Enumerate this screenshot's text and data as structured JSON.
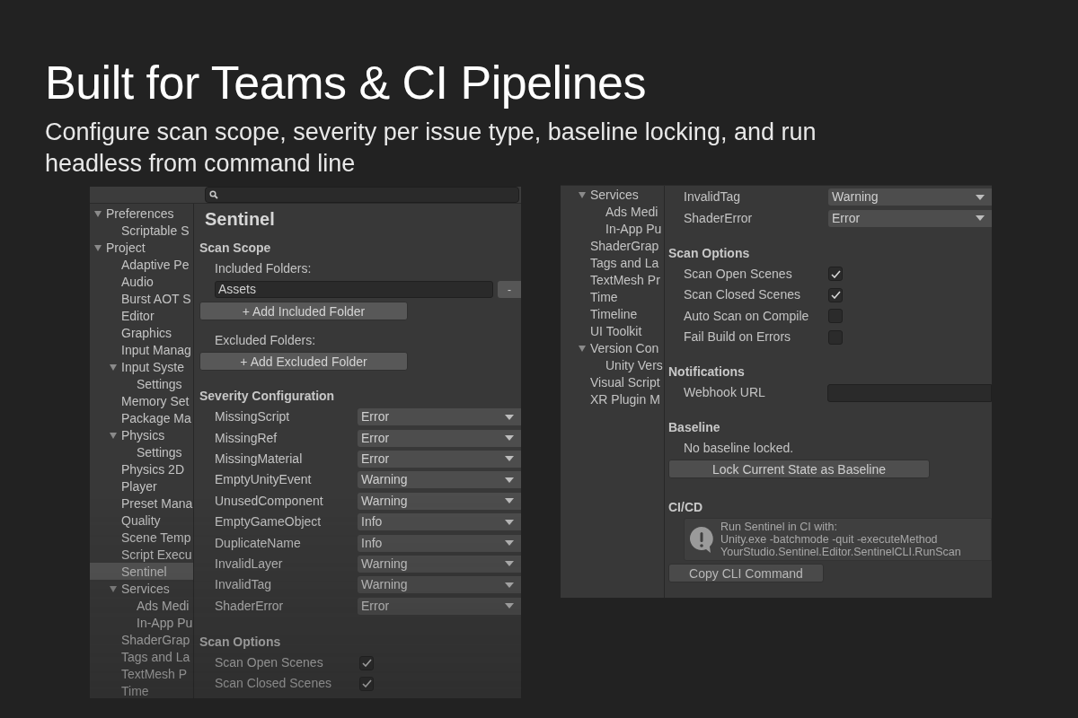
{
  "headline": "Built for Teams & CI Pipelines",
  "subheadline": "Configure scan scope, severity per issue type, baseline locking, and run headless from command line",
  "left_window": {
    "sidebar": {
      "items": [
        {
          "label": "Preferences",
          "selected": false,
          "expanded": true,
          "children": [
            {
              "label": "Scriptable S",
              "selected": false
            }
          ]
        },
        {
          "label": "Project",
          "selected": false,
          "expanded": true,
          "children": [
            {
              "label": "Adaptive Pe",
              "selected": false
            },
            {
              "label": "Audio",
              "selected": false
            },
            {
              "label": "Burst AOT S",
              "selected": false
            },
            {
              "label": "Editor",
              "selected": false
            },
            {
              "label": "Graphics",
              "selected": false
            },
            {
              "label": "Input Manag",
              "selected": false
            },
            {
              "label": "Input Syste",
              "selected": false,
              "expanded": true,
              "children": [
                {
                  "label": "Settings",
                  "selected": false
                }
              ]
            },
            {
              "label": "Memory Set",
              "selected": false
            },
            {
              "label": "Package Ma",
              "selected": false
            },
            {
              "label": "Physics",
              "selected": false,
              "expanded": true,
              "children": [
                {
                  "label": "Settings",
                  "selected": false
                }
              ]
            },
            {
              "label": "Physics 2D",
              "selected": false
            },
            {
              "label": "Player",
              "selected": false
            },
            {
              "label": "Preset Mana",
              "selected": false
            },
            {
              "label": "Quality",
              "selected": false
            },
            {
              "label": "Scene Temp",
              "selected": false
            },
            {
              "label": "Script Execu",
              "selected": false
            },
            {
              "label": "Sentinel",
              "selected": true
            },
            {
              "label": "Services",
              "selected": false,
              "expanded": true,
              "children": [
                {
                  "label": "Ads Medi",
                  "selected": false
                },
                {
                  "label": "In-App Pu",
                  "selected": false
                }
              ]
            },
            {
              "label": "ShaderGrap",
              "selected": false
            },
            {
              "label": "Tags and La",
              "selected": false
            },
            {
              "label": "TextMesh P",
              "selected": false
            },
            {
              "label": "Time",
              "selected": false
            }
          ]
        }
      ]
    },
    "title": "Sentinel",
    "scan_scope": {
      "heading": "Scan Scope",
      "included_label": "Included Folders:",
      "included_folders": [
        {
          "value": "Assets",
          "remove_button": "-"
        }
      ],
      "add_included_button": "+ Add Included Folder",
      "excluded_label": "Excluded Folders:",
      "add_excluded_button": "+ Add Excluded Folder"
    },
    "severity": {
      "heading": "Severity Configuration",
      "rows": [
        {
          "name": "MissingScript",
          "value": "Error"
        },
        {
          "name": "MissingRef",
          "value": "Error"
        },
        {
          "name": "MissingMaterial",
          "value": "Error"
        },
        {
          "name": "EmptyUnityEvent",
          "value": "Warning"
        },
        {
          "name": "UnusedComponent",
          "value": "Warning"
        },
        {
          "name": "EmptyGameObject",
          "value": "Info"
        },
        {
          "name": "DuplicateName",
          "value": "Info"
        },
        {
          "name": "InvalidLayer",
          "value": "Warning"
        },
        {
          "name": "InvalidTag",
          "value": "Warning"
        },
        {
          "name": "ShaderError",
          "value": "Error"
        }
      ]
    },
    "scan_options": {
      "heading": "Scan Options",
      "options": [
        {
          "label": "Scan Open Scenes",
          "checked": true
        },
        {
          "label": "Scan Closed Scenes",
          "checked": true
        }
      ]
    }
  },
  "right_window": {
    "sidebar": {
      "items": [
        {
          "label": "Services",
          "selected": false,
          "expanded": true,
          "children": [
            {
              "label": "Ads Medi",
              "selected": false
            },
            {
              "label": "In-App Pu",
              "selected": false
            }
          ]
        },
        {
          "label": "ShaderGrap",
          "selected": false
        },
        {
          "label": "Tags and La",
          "selected": false
        },
        {
          "label": "TextMesh Pr",
          "selected": false
        },
        {
          "label": "Time",
          "selected": false
        },
        {
          "label": "Timeline",
          "selected": false
        },
        {
          "label": "UI Toolkit",
          "selected": false
        },
        {
          "label": "Version Con",
          "selected": false,
          "expanded": true,
          "children": [
            {
              "label": "Unity Vers",
              "selected": false
            }
          ]
        },
        {
          "label": "Visual Script",
          "selected": false
        },
        {
          "label": "XR Plugin M",
          "selected": false
        }
      ]
    },
    "severity_rows": [
      {
        "name": "InvalidTag",
        "value": "Warning"
      },
      {
        "name": "ShaderError",
        "value": "Error"
      }
    ],
    "scan_options": {
      "heading": "Scan Options",
      "options": [
        {
          "label": "Scan Open Scenes",
          "checked": true
        },
        {
          "label": "Scan Closed Scenes",
          "checked": true
        },
        {
          "label": "Auto Scan on Compile",
          "checked": false
        },
        {
          "label": "Fail Build on Errors",
          "checked": false
        }
      ]
    },
    "notifications": {
      "heading": "Notifications",
      "webhook_label": "Webhook URL"
    },
    "baseline": {
      "heading": "Baseline",
      "status": "No baseline locked.",
      "button": "Lock Current State as Baseline"
    },
    "cicd": {
      "heading": "CI/CD",
      "help_lines": [
        "Run Sentinel in CI with:",
        "Unity.exe -batchmode -quit -executeMethod",
        "YourStudio.Sentinel.Editor.SentinelCLI.RunScan"
      ],
      "button": "Copy CLI Command"
    }
  }
}
